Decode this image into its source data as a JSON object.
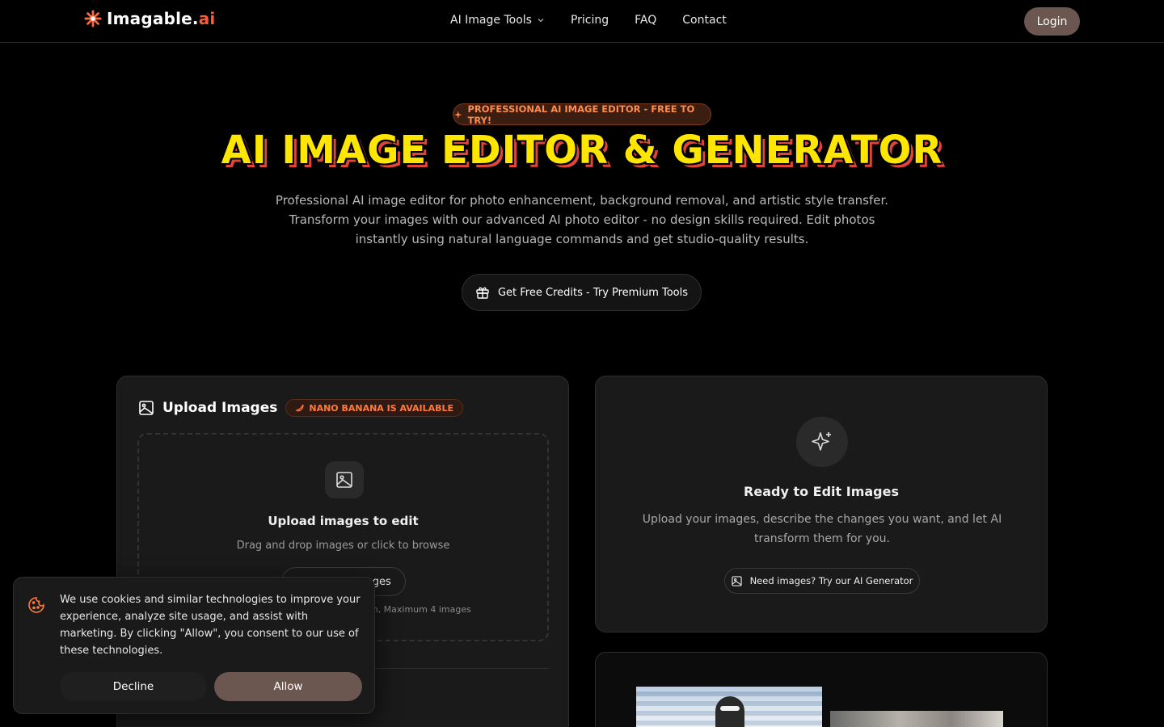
{
  "header": {
    "logo_text": "Imagable.",
    "logo_accent": "ai",
    "nav": [
      {
        "label": "AI Image Tools"
      },
      {
        "label": "Pricing"
      },
      {
        "label": "FAQ"
      },
      {
        "label": "Contact"
      }
    ],
    "login_label": "Login"
  },
  "hero": {
    "badge": "PROFESSIONAL AI IMAGE EDITOR - FREE TO TRY!",
    "title": "AI IMAGE EDITOR & GENERATOR",
    "subtitle": "Professional AI image editor for photo enhancement, background removal, and artistic style transfer. Transform your images with our advanced AI photo editor - no design skills required. Edit photos instantly using natural language commands and get studio-quality results.",
    "cta_label": "Get Free Credits - Try Premium Tools"
  },
  "upload": {
    "title": "Upload Images",
    "badge": "NANO BANANA IS AVAILABLE",
    "dropzone_title": "Upload images to edit",
    "dropzone_sub": "Drag and drop images or click to browse",
    "choose_label": "Choose Images",
    "limit_text": "each, Maximum 4 images"
  },
  "ready": {
    "title": "Ready to Edit Images",
    "subtitle": "Upload your images, describe the changes you want, and let AI transform them for you.",
    "generator_label": "Need images? Try our AI Generator"
  },
  "cookie": {
    "text": "We use cookies and similar technologies to improve your experience, analyze site usage, and assist with marketing. By clicking \"Allow\", you consent to our use of these technologies.",
    "decline_label": "Decline",
    "allow_label": "Allow"
  },
  "colors": {
    "accent": "#ff7a3c",
    "title_yellow": "#ffe600",
    "title_shadow": "#e0453a",
    "button_brown": "#6b5650"
  }
}
